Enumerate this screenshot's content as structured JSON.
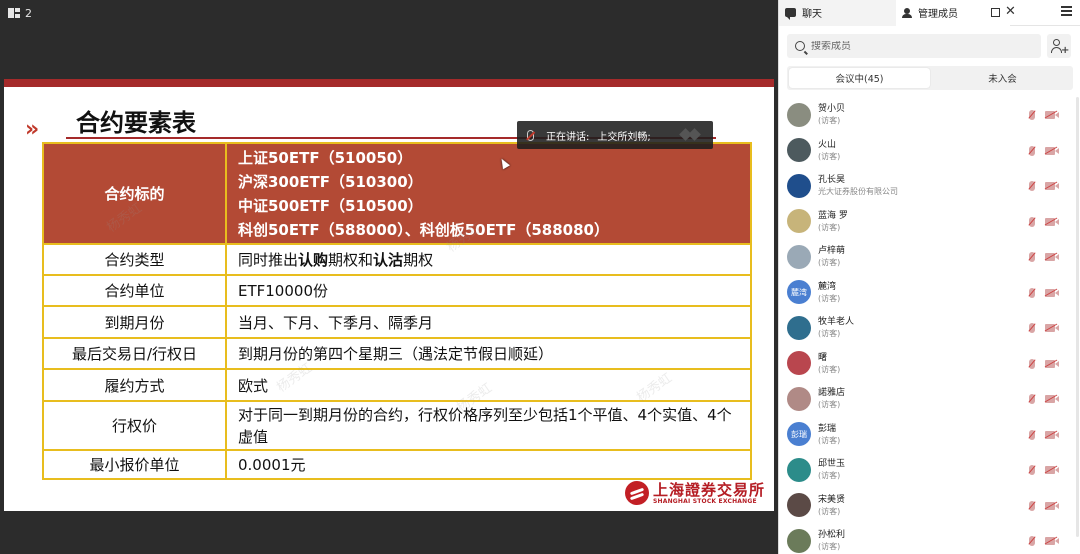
{
  "topbar": {
    "layout_count": "2"
  },
  "slide": {
    "title": "合约要素表",
    "chevrons": "»",
    "header_key": "合约标的",
    "underlyings": [
      "上证50ETF（510050）",
      "沪深300ETF（510300）",
      "中证500ETF（510500）",
      "科创50ETF（588000）、科创板50ETF（588080）"
    ],
    "rows": [
      {
        "key": "合约类型",
        "parts": [
          "同时推出",
          "认购",
          "期权和",
          "认沽",
          "期权"
        ]
      },
      {
        "key": "合约单位",
        "value": "ETF10000份"
      },
      {
        "key": "到期月份",
        "value": "当月、下月、下季月、隔季月"
      },
      {
        "key": "最后交易日/行权日",
        "value": "到期月份的第四个星期三（遇法定节假日顺延）"
      },
      {
        "key": "履约方式",
        "value": "欧式"
      },
      {
        "key": "行权价",
        "value": "对于同一到期月份的合约，行权价格序列至少包括1个平值、4个实值、4个虚值"
      },
      {
        "key": "最小报价单位",
        "value": "0.0001元"
      }
    ],
    "watermark": "杨秀虹",
    "logo_cn": "上海證券交易所",
    "logo_en": "SHANGHAI STOCK EXCHANGE"
  },
  "speaking": {
    "label": "正在讲话:",
    "name": "上交所刘畅;"
  },
  "panel": {
    "tab_chat": "聊天",
    "tab_members": "管理成员",
    "search_placeholder": "搜索成员",
    "seg_in_meeting": "会议中(45)",
    "seg_not_joined": "未入会",
    "members": [
      {
        "name": "贺小贝",
        "sub": "(访客)",
        "avatar_color": "#8a8d80"
      },
      {
        "name": "火山",
        "sub": "(访客)",
        "avatar_color": "#4d5a5e"
      },
      {
        "name": "孔长昊",
        "sub": "光大证券股份有限公司",
        "avatar_color": "#1f4e8c"
      },
      {
        "name": "蓝海 罗",
        "sub": "(访客)",
        "avatar_color": "#c7b47a"
      },
      {
        "name": "卢梓萌",
        "sub": "(访客)",
        "avatar_color": "#9aa9b6"
      },
      {
        "name": "麓湾",
        "sub": "(访客)",
        "avatar_color": "#4a7fd1",
        "avatar_text": "麓湾"
      },
      {
        "name": "牧羊老人",
        "sub": "(访客)",
        "avatar_color": "#2f6e8e"
      },
      {
        "name": "曙",
        "sub": "(访客)",
        "avatar_color": "#b9464e"
      },
      {
        "name": "諾雅店",
        "sub": "(访客)",
        "avatar_color": "#b08a86"
      },
      {
        "name": "彭瑞",
        "sub": "(访客)",
        "avatar_color": "#4a7fd1",
        "avatar_text": "彭瑞"
      },
      {
        "name": "邱世玉",
        "sub": "(访客)",
        "avatar_color": "#2c8c8a"
      },
      {
        "name": "宋美贤",
        "sub": "(访客)",
        "avatar_color": "#5b4a46"
      },
      {
        "name": "孙松利",
        "sub": "(访客)",
        "avatar_color": "#6b7b5a"
      }
    ]
  }
}
